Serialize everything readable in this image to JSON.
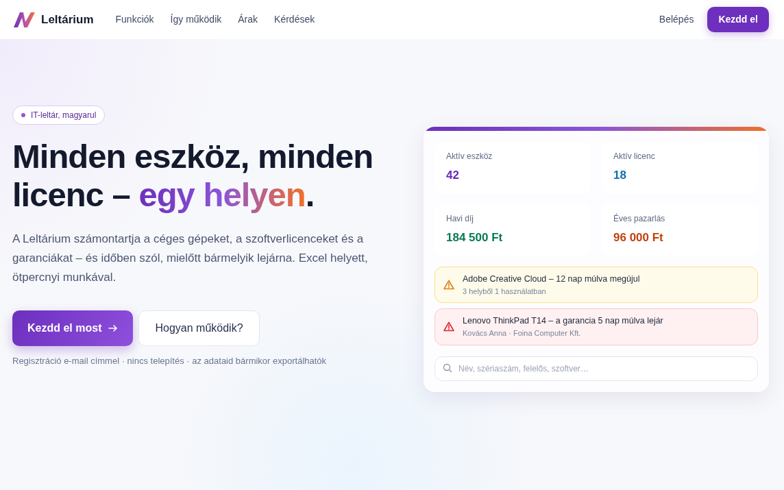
{
  "brand": {
    "name": "Leltárium"
  },
  "nav": [
    {
      "label": "Funkciók"
    },
    {
      "label": "Így működik"
    },
    {
      "label": "Árak"
    },
    {
      "label": "Kérdések"
    }
  ],
  "login": {
    "label": "Belépés"
  },
  "cta": {
    "label": "Kezdd el"
  },
  "hero": {
    "badge": "IT-leltár, magyarul",
    "headline": {
      "lead": "Minden eszköz, minden licenc –",
      "highlight": "egy helyen",
      "tail": "."
    },
    "text": "A Leltárium számontartja a céges gépeket, a szoftverlicenceket és a garanciákat – és időben szól, mielőtt bármelyik lejárna. Excel helyett, ötpercnyi munkával.",
    "primary_button": "Kezdd el most",
    "secondary_button": "Hogyan működik?",
    "note": "Regisztráció e-mail címmel · nincs telepítés · az adataid bármikor exportálhatók"
  },
  "panel": {
    "stats": [
      {
        "label": "Aktív eszköz",
        "value": "42",
        "color": "#6d28b9"
      },
      {
        "label": "Aktív licenc",
        "value": "18",
        "color": "#0b6fb3"
      },
      {
        "label": "Havi díj",
        "value": "184 500 Ft",
        "color": "#077a55"
      },
      {
        "label": "Éves pazarlás",
        "value": "96 000 Ft",
        "color": "#c2410c"
      }
    ],
    "alerts": [
      {
        "kind": "warning",
        "title": "Adobe Creative Cloud – 12 nap múlva megújul",
        "detail": "3 helyből 1 használatban"
      },
      {
        "kind": "danger",
        "title": "Lenovo ThinkPad T14 – a garancia 5 nap múlva lejár",
        "detail": "Kovács Anna · Foina Computer Kft."
      }
    ],
    "search": {
      "placeholder": "Név, szériaszám, felelős, szoftver…"
    }
  }
}
